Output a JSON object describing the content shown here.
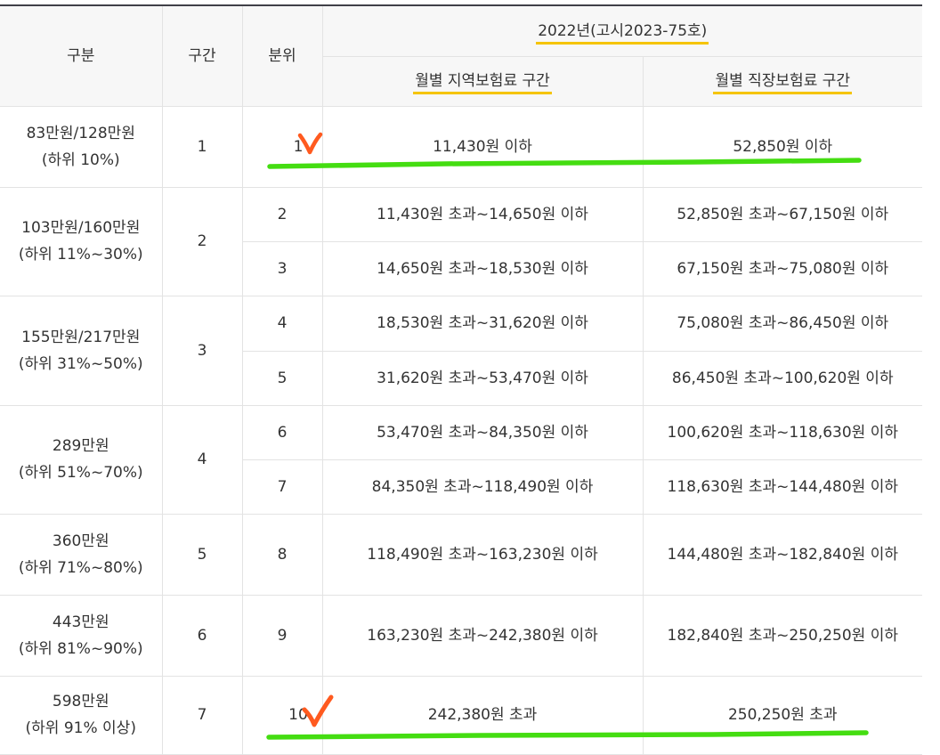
{
  "table": {
    "headers": {
      "category": "구분",
      "section": "구간",
      "decile": "분위",
      "year_group": "2022년(고시2023-75호)",
      "regional": "월별 지역보험료 구간",
      "workplace": "월별 직장보험료 구간"
    },
    "groups": [
      {
        "income": "83만원/128만원",
        "percent": "(하위 10%)",
        "section": "1",
        "rows": [
          {
            "decile": "1",
            "regional": "11,430원 이하",
            "workplace": "52,850원 이하"
          }
        ]
      },
      {
        "income": "103만원/160만원",
        "percent": "(하위 11%~30%)",
        "section": "2",
        "rows": [
          {
            "decile": "2",
            "regional": "11,430원 초과~14,650원 이하",
            "workplace": "52,850원 초과~67,150원 이하"
          },
          {
            "decile": "3",
            "regional": "14,650원 초과~18,530원 이하",
            "workplace": "67,150원 초과~75,080원 이하"
          }
        ]
      },
      {
        "income": "155만원/217만원",
        "percent": "(하위 31%~50%)",
        "section": "3",
        "rows": [
          {
            "decile": "4",
            "regional": "18,530원 초과~31,620원 이하",
            "workplace": "75,080원 초과~86,450원 이하"
          },
          {
            "decile": "5",
            "regional": "31,620원 초과~53,470원 이하",
            "workplace": "86,450원 초과~100,620원 이하"
          }
        ]
      },
      {
        "income": "289만원",
        "percent": "(하위 51%~70%)",
        "section": "4",
        "rows": [
          {
            "decile": "6",
            "regional": "53,470원 초과~84,350원 이하",
            "workplace": "100,620원 초과~118,630원 이하"
          },
          {
            "decile": "7",
            "regional": "84,350원 초과~118,490원 이하",
            "workplace": "118,630원 초과~144,480원 이하"
          }
        ]
      },
      {
        "income": "360만원",
        "percent": "(하위 71%~80%)",
        "section": "5",
        "rows": [
          {
            "decile": "8",
            "regional": "118,490원 초과~163,230원 이하",
            "workplace": "144,480원 초과~182,840원 이하"
          }
        ]
      },
      {
        "income": "443만원",
        "percent": "(하위 81%~90%)",
        "section": "6",
        "rows": [
          {
            "decile": "9",
            "regional": "163,230원 초과~242,380원 이하",
            "workplace": "182,840원 초과~250,250원 이하"
          }
        ]
      },
      {
        "income": "598만원",
        "percent": "(하위 91% 이상)",
        "section": "7",
        "rows": [
          {
            "decile": "10",
            "regional": "242,380원 초과",
            "workplace": "250,250원 초과"
          }
        ]
      }
    ]
  },
  "annotations": {
    "highlight_color": "#f5c400",
    "underline_color": "#44dd11",
    "checkmark_color": "#ff5a1f",
    "checkmark_icon": "checkmark-icon"
  }
}
